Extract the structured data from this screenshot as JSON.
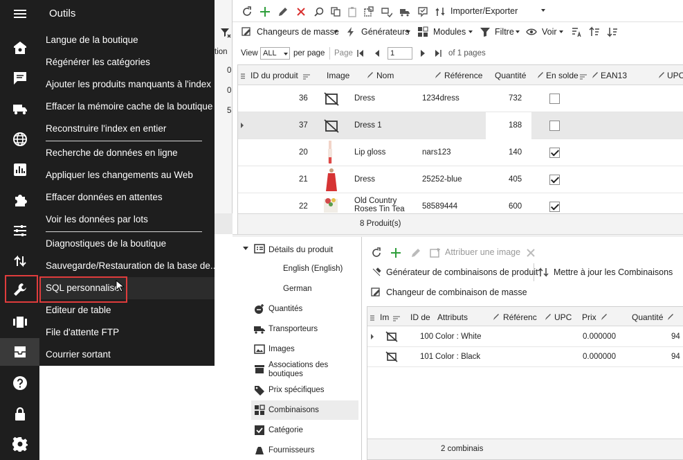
{
  "drawer": {
    "title": "Outils",
    "items": [
      "Langue de la boutique",
      "Régénérer les catégories",
      "Ajouter les produits manquants à l'index",
      "Effacer la mémoire cache de la boutique",
      "Reconstruire l'index en entier",
      "Recherche de données en ligne",
      "Appliquer les changements au Web",
      "Effacer données en attentes",
      "Voir les données par lots",
      "Diagnostiques de la boutique",
      "Sauvegarde/Restauration de la base de...",
      "SQL personnalisé",
      "Editeur de table",
      "File d'attente FTP",
      "Courrier sortant"
    ]
  },
  "left_partial": {
    "col_label": "tion",
    "values": [
      "0",
      "0",
      "5"
    ]
  },
  "toolbar": {
    "import_export": "Importer/Exporter",
    "mass_changers": "Changeurs de masse",
    "generators": "Générateurs",
    "modules": "Modules",
    "filter": "Filtre",
    "view": "Voir"
  },
  "paging": {
    "view_label": "View",
    "view_value": "ALL",
    "per_page": "per page",
    "page_label": "Page",
    "page_value": "1",
    "of_pages": "of 1 pages"
  },
  "products": {
    "columns": [
      "ID du produit",
      "Image",
      "Nom",
      "Référence",
      "Quantité",
      "En solde",
      "EAN13",
      "UPC"
    ],
    "rows": [
      {
        "id": "36",
        "name": "Dress",
        "ref": "1234dress",
        "qty": "732",
        "sale": false
      },
      {
        "id": "37",
        "name": "Dress 1",
        "ref": "",
        "qty": "188",
        "sale": false
      },
      {
        "id": "20",
        "name": "Lip gloss",
        "ref": "nars123",
        "qty": "140",
        "sale": true
      },
      {
        "id": "21",
        "name": "Dress",
        "ref": "25252-blue",
        "qty": "405",
        "sale": true
      },
      {
        "id": "22",
        "name": "Old Country Roses Tin Tea",
        "ref": "58589444",
        "qty": "600",
        "sale": true
      }
    ],
    "footer": "8 Produit(s)"
  },
  "details_tree": {
    "header": "Détails du produit",
    "languages": [
      "English (English)",
      "German"
    ],
    "items": [
      "Quantités",
      "Transporteurs",
      "Images",
      "Associations des boutiques",
      "Prix spécifiques",
      "Combinaisons",
      "Catégorie",
      "Fournisseurs"
    ]
  },
  "combos": {
    "assign_image": "Attribuer une image",
    "generator": "Générateur de combinaisons de produit",
    "update": "Mettre à jour les Combinaisons",
    "mass_changer": "Changeur de combinaison de masse",
    "columns": [
      "Im",
      "ID de",
      "Attributs",
      "Référenc",
      "UPC",
      "Prix",
      "Quantité"
    ],
    "rows": [
      {
        "id": "100",
        "attr": "Color : White",
        "price": "0.000000",
        "qty": "94"
      },
      {
        "id": "101",
        "attr": "Color : Black",
        "price": "0.000000",
        "qty": "94"
      }
    ],
    "footer": "2 combinais"
  },
  "colors": {
    "sidebar_bg": "#1e1e1e",
    "highlight": "#e03c3c",
    "selected_row": "#e8e8e8",
    "accent_green": "#2e9e3a",
    "accent_red": "#d9302f"
  }
}
